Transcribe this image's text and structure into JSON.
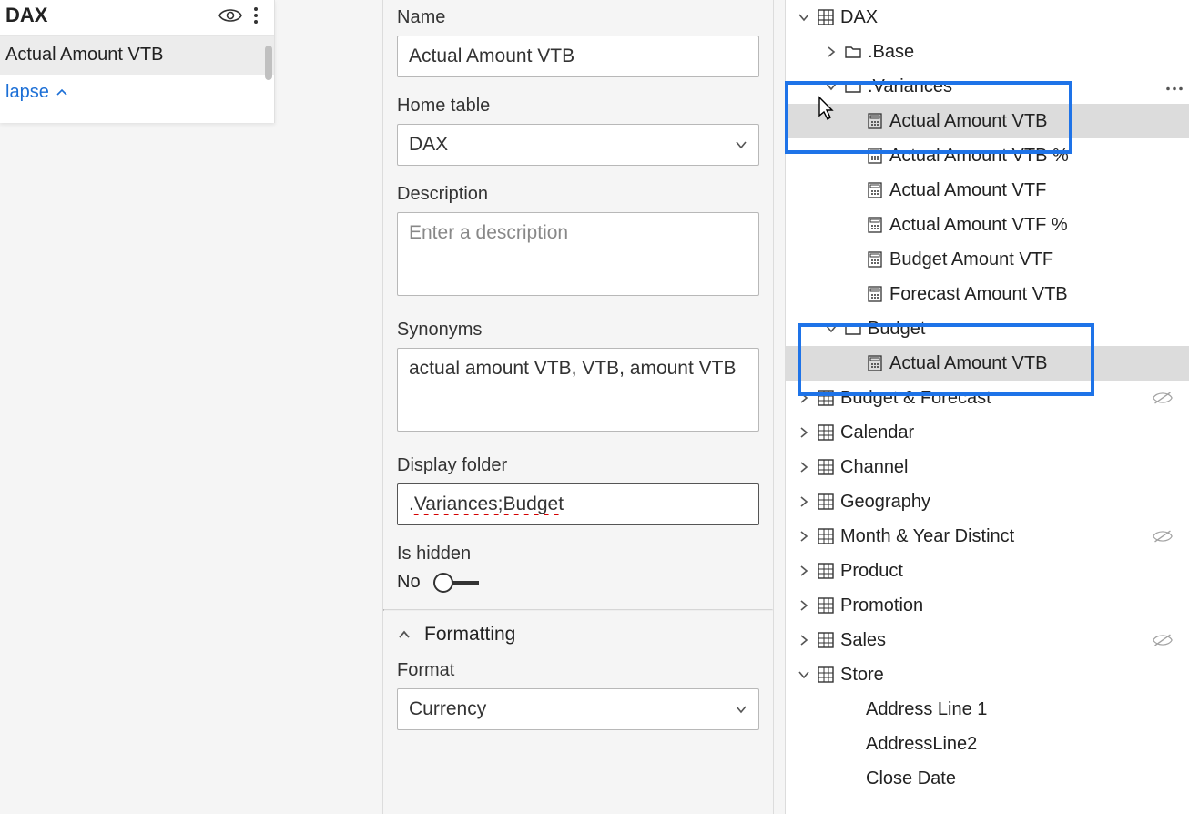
{
  "left": {
    "title": "DAX",
    "field": "Actual Amount VTB",
    "collapse": "lapse"
  },
  "props": {
    "name_label": "Name",
    "name_value": "Actual Amount VTB",
    "home_table_label": "Home table",
    "home_table_value": "DAX",
    "description_label": "Description",
    "description_placeholder": "Enter a description",
    "synonyms_label": "Synonyms",
    "synonyms_value": "actual amount VTB, VTB, amount VTB",
    "display_folder_label": "Display folder",
    "display_folder_value": ".Variances;Budget",
    "is_hidden_label": "Is hidden",
    "is_hidden_value": "No",
    "formatting_label": "Formatting",
    "format_label": "Format",
    "format_value": "Currency"
  },
  "tree": {
    "dax": "DAX",
    "base": ".Base",
    "variances": ".Variances",
    "items_var": [
      "Actual Amount VTB",
      "Actual Amount VTB %",
      "Actual Amount VTF",
      "Actual Amount VTF %",
      "Budget Amount VTF",
      "Forecast Amount VTB"
    ],
    "budget": "Budget",
    "budget_item": "Actual Amount VTB",
    "tables": [
      "Budget & Forecast",
      "Calendar",
      "Channel",
      "Geography",
      "Month & Year Distinct",
      "Product",
      "Promotion",
      "Sales"
    ],
    "store": "Store",
    "store_cols": [
      "Address Line 1",
      "AddressLine2",
      "Close Date"
    ]
  }
}
